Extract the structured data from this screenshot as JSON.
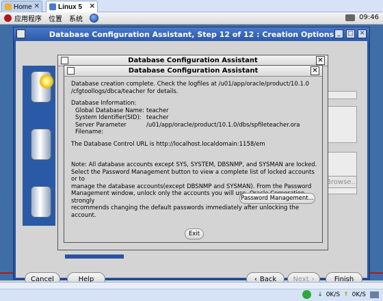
{
  "vm_tabs": [
    {
      "label": "Home"
    },
    {
      "label": "Linux 5"
    }
  ],
  "gnome_panel": {
    "menus": [
      "应用程序",
      "位置",
      "系统"
    ],
    "clock": "09:46"
  },
  "window": {
    "title": "Database Configuration Assistant, Step 12 of 12 : Creation Options",
    "background_browse_label": "Browse...",
    "buttons": {
      "cancel": "Cancel",
      "help": "Help",
      "back": "Back",
      "next": "Next",
      "finish": "Finish"
    }
  },
  "outer_dialog": {
    "title": "Database Configuration Assistant"
  },
  "dialog": {
    "title": "Database Configuration Assistant",
    "message_line1": "Database creation complete. Check the logfiles at /u01/app/oracle/product/10.1.0",
    "message_line2": "/cfgtoollogs/dbca/teacher for details.",
    "info_heading": "Database Information:",
    "info": [
      {
        "label": "Global Database Name:",
        "value": "teacher"
      },
      {
        "label": "System Identifier(SID):",
        "value": "teacher"
      },
      {
        "label": "Server Parameter Filename:",
        "value": "/u01/app/oracle/product/10.1.0/dbs/spfileteacher.ora"
      }
    ],
    "control_url_text": "The Database Control URL is http://localhost.localdomain:1158/em",
    "note_lines": [
      "Note: All database accounts except SYS, SYSTEM, DBSNMP, and SYSMAN are locked.",
      "Select the Password Management button to view a complete list of locked accounts or to",
      "manage the database accounts(except DBSNMP and SYSMAN). From the Password",
      "Management window, unlock only the accounts you will use. Oracle Corporation strongly",
      "recommends changing the default passwords immediately after unlocking the account."
    ],
    "password_button": "Password Management...",
    "exit_button": "Exit"
  },
  "status_bar": {
    "down_rate": "0K/S",
    "up_rate": "0K/S"
  }
}
